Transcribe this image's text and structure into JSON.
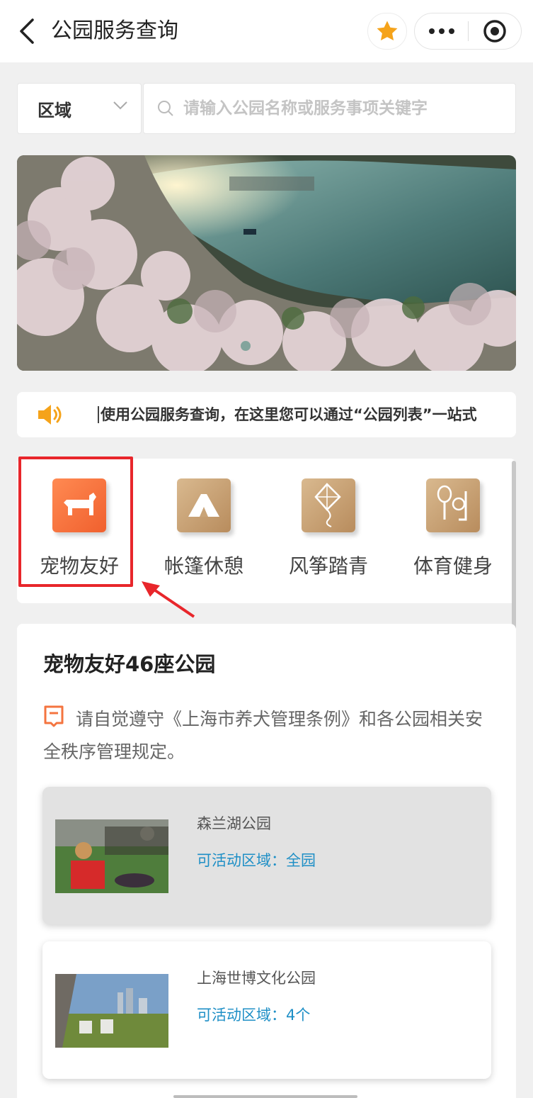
{
  "nav": {
    "title": "公园服务查询",
    "back_icon": "chevron-left-icon",
    "favorite_icon": "star-icon",
    "more_icon": "more-dots-icon",
    "close_icon": "target-close-icon"
  },
  "search": {
    "region_label": "区域",
    "placeholder": "请输入公园名称或服务事项关键字"
  },
  "notice": {
    "text": "使用公园服务查询，在这里您可以通过“公园列表”一站式"
  },
  "categories": [
    {
      "label": "宠物友好",
      "icon": "dog-icon",
      "color": "#f4743f",
      "selected": true
    },
    {
      "label": "帐篷休憩",
      "icon": "tent-icon",
      "color": "#c9a478",
      "selected": false
    },
    {
      "label": "风筝踏青",
      "icon": "kite-icon",
      "color": "#c9a478",
      "selected": false
    },
    {
      "label": "体育健身",
      "icon": "sports-icon",
      "color": "#c9a478",
      "selected": false
    }
  ],
  "results": {
    "title": "宠物友好46座公园",
    "rule_text": "请自觉遵守《上海市养犬管理条例》和各公园相关安全秩序管理规定。",
    "parks": [
      {
        "name": "森兰湖公园",
        "area": "可活动区域：全园"
      },
      {
        "name": "上海世博文化公园",
        "area": "可活动区域：4个"
      }
    ]
  },
  "colors": {
    "accent_orange": "#f4743f",
    "link_blue": "#1e8fc6",
    "highlight_red": "#e8262b",
    "star_orange": "#f5a31a"
  }
}
